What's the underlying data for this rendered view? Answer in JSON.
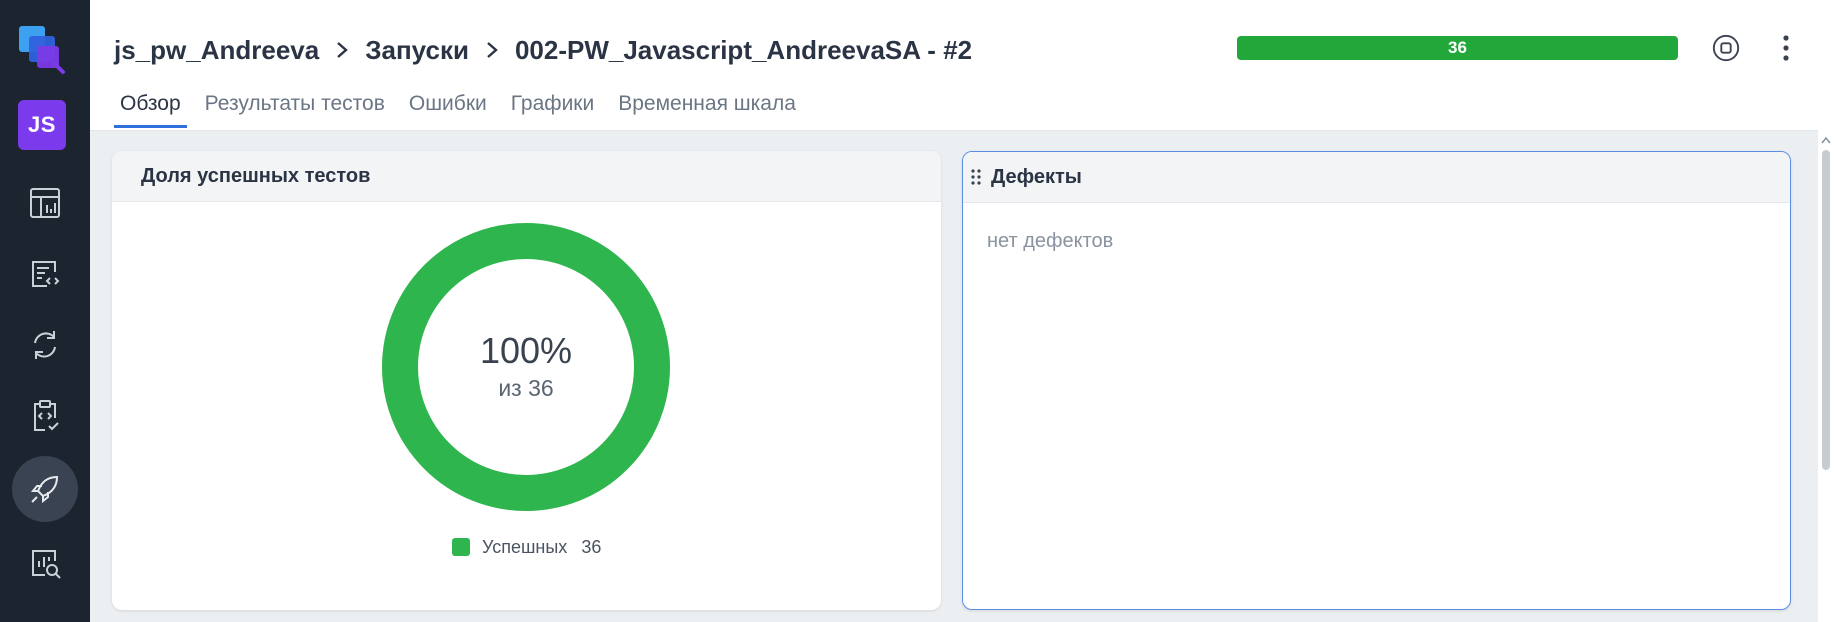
{
  "sidebar": {
    "logo_icon": "product-logo-icon",
    "avatar_initials": "JS",
    "avatar_color": "#7c3aed",
    "items": [
      {
        "icon": "dashboard-icon",
        "active": false
      },
      {
        "icon": "test-cases-icon",
        "active": false
      },
      {
        "icon": "sync-icon",
        "active": false
      },
      {
        "icon": "test-plan-icon",
        "active": false
      },
      {
        "icon": "rocket-launches-icon",
        "active": true
      },
      {
        "icon": "analytics-search-icon",
        "active": false
      }
    ]
  },
  "breadcrumb": {
    "project": "js_pw_Andreeva",
    "section": "Запуски",
    "current": "002-PW_Javascript_AndreevaSA - #2"
  },
  "progress": {
    "label": "36",
    "fraction_passed": 1.0,
    "color": "#22a83a"
  },
  "header_actions": {
    "stop_icon": "stop-icon",
    "more_icon": "more-vertical-icon"
  },
  "tabs": [
    {
      "label": "Обзор",
      "active": true
    },
    {
      "label": "Результаты тестов",
      "active": false
    },
    {
      "label": "Ошибки",
      "active": false
    },
    {
      "label": "Графики",
      "active": false
    },
    {
      "label": "Временная шкала",
      "active": false
    }
  ],
  "success_widget": {
    "title": "Доля успешных тестов",
    "percent_text": "100%",
    "subtitle": "из 36",
    "legend": {
      "label": "Успешных",
      "count": "36",
      "color": "#2fb54d"
    }
  },
  "defects_widget": {
    "title": "Дефекты",
    "empty_text": "нет дефектов"
  },
  "colors": {
    "accent": "#2f6fdb",
    "sidebar_bg": "#1c2430",
    "success": "#2fb54d"
  }
}
